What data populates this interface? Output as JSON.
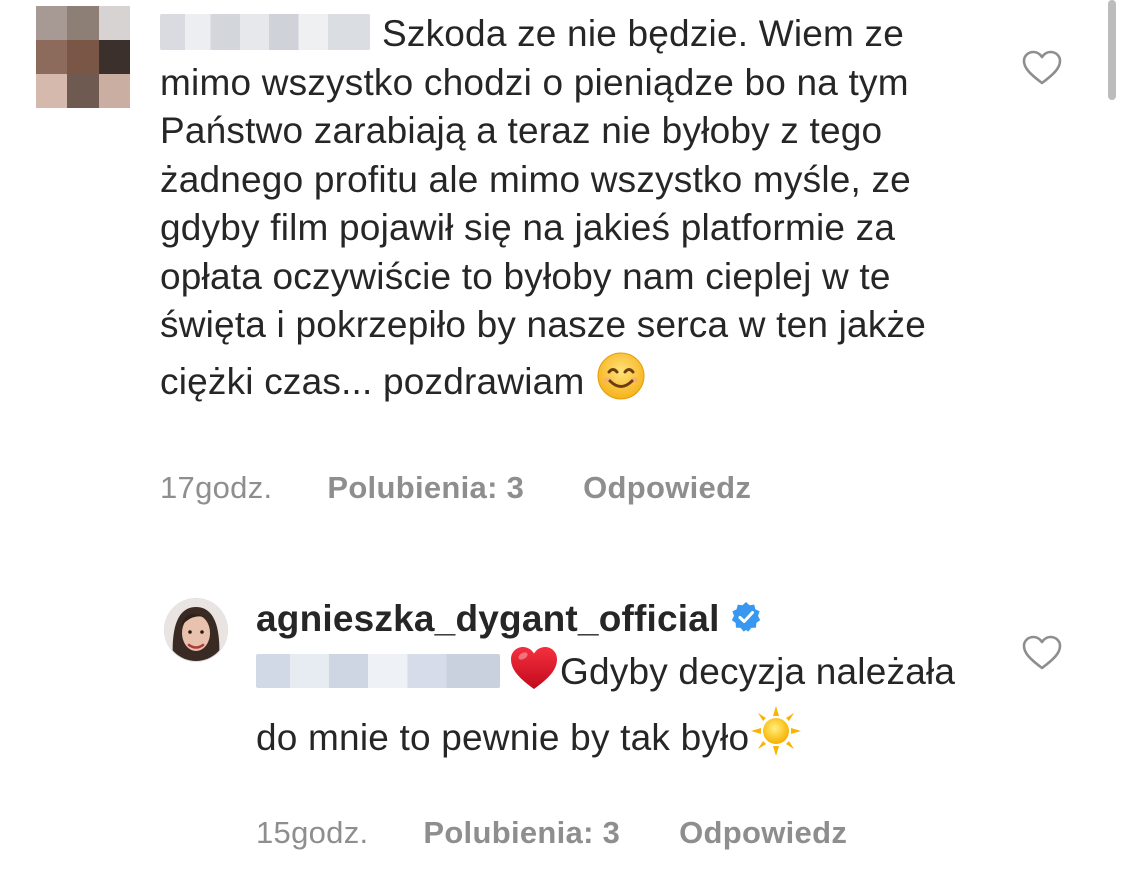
{
  "comments": [
    {
      "username_redacted": true,
      "text": "Szkoda ze nie będzie. Wiem ze mimo wszystko chodzi o pieniądze bo na tym Państwo zarabiają a teraz nie byłoby z tego żadnego profitu ale mimo wszystko myśle, ze gdyby film pojawił się na jakieś platformie za opłata oczywiście to byłoby nam cieplej w te święta i pokrzepiło by nasze serca w ten jakże ciężki czas... pozdrawiam",
      "trailing_emoji": "smiling-face-icon",
      "time": "17godz.",
      "likes_label": "Polubienia: 3",
      "reply_label": "Odpowiedz"
    },
    {
      "username": "agnieszka_dygant_official",
      "verified": true,
      "mention_redacted": true,
      "lead_emoji": "red-heart-icon",
      "text": "Gdyby decyzja należała do mnie to pewnie by tak było",
      "trailing_emoji": "sun-icon",
      "time": "15godz.",
      "likes_label": "Polubienia: 3",
      "reply_label": "Odpowiedz"
    }
  ],
  "colors": {
    "text": "#262626",
    "meta": "#8e8e8e",
    "verified": "#3897f0",
    "heart": "#e0162b"
  }
}
